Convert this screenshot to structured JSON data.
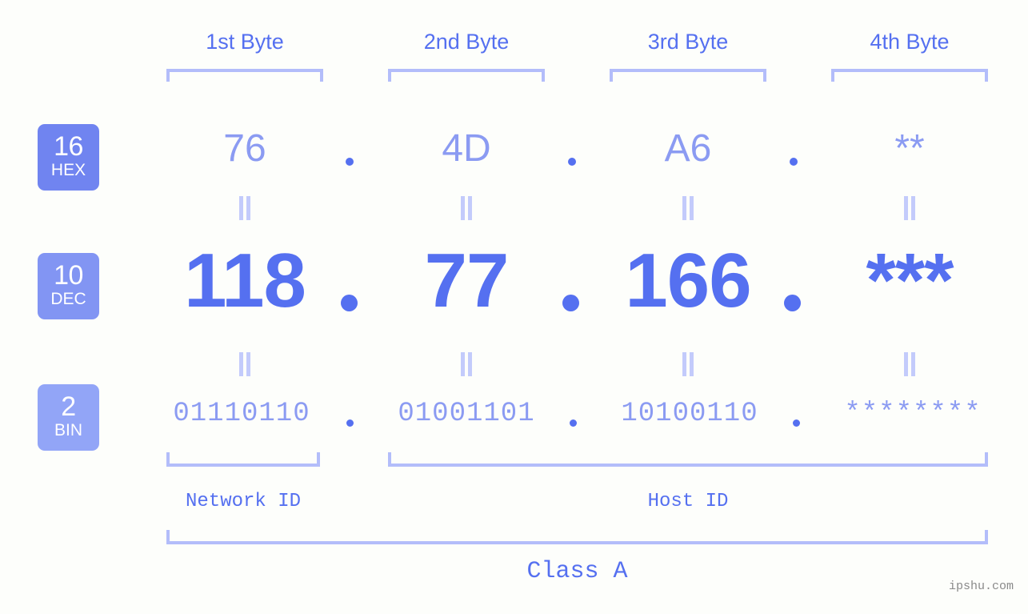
{
  "page": {
    "background_color": "#fdfefb",
    "accent_color": "#5570f0",
    "accent_light_color": "#8b9bf2",
    "bracket_color": "#b3bdfa",
    "watermark": "ipshu.com"
  },
  "byte_headers": [
    {
      "label": "1st Byte"
    },
    {
      "label": "2nd Byte"
    },
    {
      "label": "3rd Byte"
    },
    {
      "label": "4th Byte"
    }
  ],
  "bases": [
    {
      "number": "16",
      "name": "HEX",
      "color": "#7084f0"
    },
    {
      "number": "10",
      "name": "DEC",
      "color": "#8295f3"
    },
    {
      "number": "2",
      "name": "BIN",
      "color": "#92a5f7"
    }
  ],
  "rows": {
    "hex": {
      "base_number": "16",
      "base_name": "HEX",
      "values": [
        "76",
        "4D",
        "A6",
        "**"
      ],
      "separator": "."
    },
    "dec": {
      "base_number": "10",
      "base_name": "DEC",
      "values": [
        "118",
        "77",
        "166",
        "***"
      ],
      "separator": "."
    },
    "bin": {
      "base_number": "2",
      "base_name": "BIN",
      "values": [
        "01110110",
        "01001101",
        "10100110",
        "********"
      ],
      "separator": "."
    }
  },
  "equals_sign": "=",
  "segments": {
    "network_id": "Network ID",
    "host_id": "Host ID"
  },
  "class": {
    "label": "Class A"
  }
}
